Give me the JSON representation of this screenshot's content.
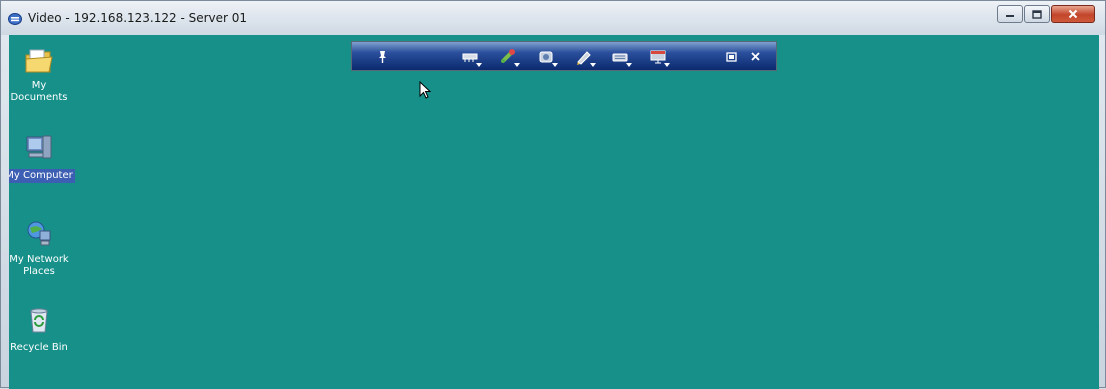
{
  "window": {
    "title": "Video - 192.168.123.122 - Server 01",
    "controls": [
      "minimize",
      "maximize",
      "close"
    ]
  },
  "colors": {
    "desktop": "#17908a",
    "toolbar_top": "#7fa0cf",
    "toolbar_bottom": "#0b2a6e",
    "selection": "#3d5fb3",
    "close_button": "#c2452b"
  },
  "desktop_icons": [
    {
      "label": "My Documents",
      "icon": "folder-documents-icon",
      "selected": false
    },
    {
      "label": "My Computer",
      "icon": "computer-icon",
      "selected": true
    },
    {
      "label": "My Network Places",
      "icon": "network-places-icon",
      "selected": false
    },
    {
      "label": "Recycle Bin",
      "icon": "recycle-bin-icon",
      "selected": false
    }
  ],
  "toolbar": {
    "items": [
      {
        "icon": "pin-icon",
        "dropdown": false
      },
      {
        "icon": "network-adapter-icon",
        "dropdown": true
      },
      {
        "icon": "usb-icon",
        "dropdown": true
      },
      {
        "icon": "camera-icon",
        "dropdown": true
      },
      {
        "icon": "pen-tool-icon",
        "dropdown": true
      },
      {
        "icon": "keyboard-icon",
        "dropdown": true
      },
      {
        "icon": "monitor-settings-icon",
        "dropdown": true
      },
      {
        "icon": "restore-icon",
        "dropdown": false
      },
      {
        "icon": "close-icon",
        "dropdown": false
      }
    ]
  }
}
